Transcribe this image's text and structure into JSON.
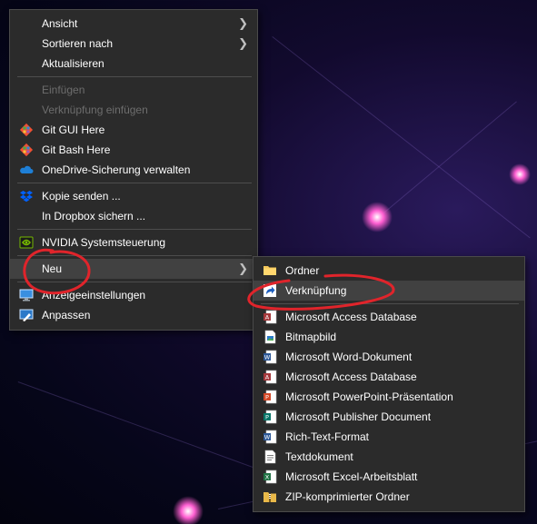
{
  "context_menu": {
    "items": [
      {
        "label": "Ansicht",
        "submenu": true
      },
      {
        "label": "Sortieren nach",
        "submenu": true
      },
      {
        "label": "Aktualisieren"
      },
      {
        "label": "Einfügen",
        "disabled": true
      },
      {
        "label": "Verknüpfung einfügen",
        "disabled": true
      },
      {
        "label": "Git GUI Here",
        "icon": "git-icon"
      },
      {
        "label": "Git Bash Here",
        "icon": "git-icon"
      },
      {
        "label": "OneDrive-Sicherung verwalten",
        "icon": "onedrive-icon"
      },
      {
        "label": "Kopie senden ...",
        "icon": "dropbox-icon"
      },
      {
        "label": "In Dropbox sichern ..."
      },
      {
        "label": "NVIDIA Systemsteuerung",
        "icon": "nvidia-icon"
      },
      {
        "label": "Neu",
        "submenu": true,
        "active": true
      },
      {
        "label": "Anzeigeeinstellungen",
        "icon": "display-settings-icon"
      },
      {
        "label": "Anpassen",
        "icon": "personalize-icon"
      }
    ]
  },
  "new_submenu": {
    "items": [
      {
        "label": "Ordner",
        "icon": "folder-icon"
      },
      {
        "label": "Verknüpfung",
        "icon": "shortcut-icon",
        "active": true
      },
      {
        "label": "Microsoft Access Database",
        "icon": "access-icon"
      },
      {
        "label": "Bitmapbild",
        "icon": "bitmap-icon"
      },
      {
        "label": "Microsoft Word-Dokument",
        "icon": "word-icon"
      },
      {
        "label": "Microsoft Access Database",
        "icon": "access-icon"
      },
      {
        "label": "Microsoft PowerPoint-Präsentation",
        "icon": "powerpoint-icon"
      },
      {
        "label": "Microsoft Publisher Document",
        "icon": "publisher-icon"
      },
      {
        "label": "Rich-Text-Format",
        "icon": "rtf-icon"
      },
      {
        "label": "Textdokument",
        "icon": "text-document-icon"
      },
      {
        "label": "Microsoft Excel-Arbeitsblatt",
        "icon": "excel-icon"
      },
      {
        "label": "ZIP-komprimierter Ordner",
        "icon": "zip-folder-icon"
      }
    ]
  },
  "colors": {
    "menu_background": "#2b2b2b",
    "menu_hover": "#414141",
    "disabled_text": "#6d6d6d",
    "annotation_red": "#e0242b"
  }
}
